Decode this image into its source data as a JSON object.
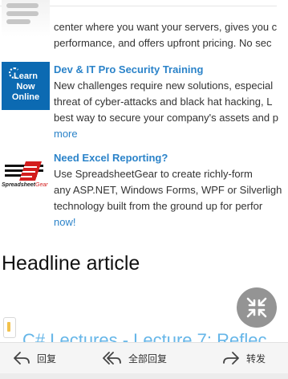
{
  "ads": [
    {
      "title": "",
      "lines": [
        "center where you want your servers, gives you c",
        "performance, and offers upfront pricing. No sec"
      ],
      "link": ""
    },
    {
      "title": "Dev & IT Pro Security Training",
      "image_text": [
        "Learn",
        "Now",
        "Online"
      ],
      "lines": [
        "New challenges require new solutions, especial",
        "threat of cyber-attacks and black hat hacking, L",
        "best way to secure your company's assets and p"
      ],
      "link": "more"
    },
    {
      "title": "Need Excel Reporting?",
      "logo_text": "Spreadsheet",
      "logo_text_accent": "Gear",
      "lines": [
        "Use SpreadsheetGear to create richly-form",
        "any ASP.NET, Windows Forms, WPF or Silverligh",
        "technology built from the ground up for perfor"
      ],
      "link": "now!"
    }
  ],
  "headline": "Headline article",
  "article_link": "C# Lectures - Lecture 7: Reflec",
  "fab_icon": "collapse-arrows-icon",
  "bottom_bar": {
    "reply": "回复",
    "reply_all": "全部回复",
    "forward": "转发"
  },
  "colors": {
    "link": "#2b83c9",
    "article_link": "#66b6e8",
    "learn_box": "#0c6ab2",
    "fab": "#8f8f8f"
  }
}
